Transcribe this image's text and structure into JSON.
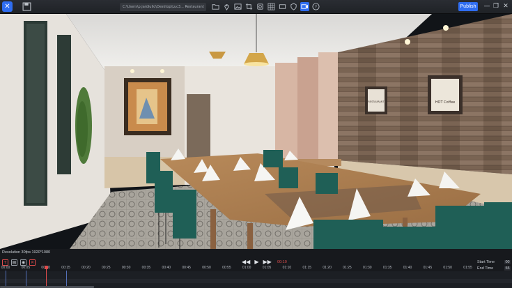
{
  "toolbar": {
    "logo_glyph": "✕",
    "path_text": "C:\\Users\\p.jardiullo\\Desktop\\Luc3... Restaurant",
    "publish_label": "Publish",
    "icons": [
      "folder-icon",
      "location-pin-icon",
      "image-icon",
      "crop-icon",
      "layers-icon",
      "grid-icon",
      "rectangle-icon",
      "shield-icon",
      "video-icon",
      "help-icon"
    ],
    "active_icon": "video-icon",
    "window_controls": [
      "—",
      "❐",
      "✕"
    ]
  },
  "viewport": {
    "signs": [
      "RESTAURANT",
      "HOT Coffee"
    ]
  },
  "timeline": {
    "resolution": "Resolution 30fps 1920*1080",
    "current_time": "00:10",
    "start_time_label": "Start Time",
    "start_time_value": "00",
    "end_time_label": "End Time",
    "end_time_value": "55",
    "ticks": [
      "00:00",
      "00:05",
      "00:10",
      "00:15",
      "00:20",
      "00:25",
      "00:30",
      "00:35",
      "00:40",
      "00:45",
      "00:50",
      "00:55",
      "01:00",
      "01:05",
      "01:10",
      "01:15",
      "01:20",
      "01:25",
      "01:30",
      "01:35",
      "01:40",
      "01:45",
      "01:50",
      "01:55"
    ],
    "keyframes": [
      "00:00",
      "00:05",
      "00:10",
      "00:15"
    ],
    "playhead": "00:10",
    "accent_color": "#2f6df0",
    "playhead_color": "#e04c4c"
  }
}
